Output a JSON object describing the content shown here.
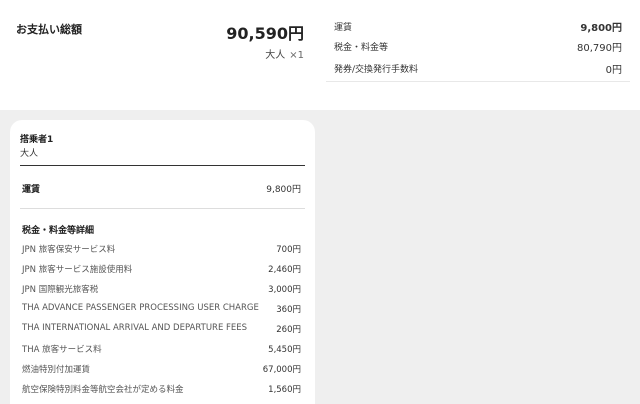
{
  "total": {
    "label": "お支払い総額",
    "amount": "90,590円",
    "passenger_type": "大人",
    "passenger_count": "×1"
  },
  "summary": [
    {
      "label": "運賃",
      "value": "9,800円",
      "bold": true
    },
    {
      "label": "税金・料金等",
      "value": "80,790円",
      "bold": false
    },
    {
      "label": "発券/交換発行手数料",
      "value": "0円",
      "bold": false
    }
  ],
  "passenger": {
    "name": "搭乗者1",
    "type": "大人",
    "fare_label": "運賃",
    "fare_value": "9,800円",
    "details_title": "税金・料金等詳細",
    "details": [
      {
        "label": "JPN 旅客保安サービス料",
        "value": "700円"
      },
      {
        "label": "JPN 旅客サービス施設使用料",
        "value": "2,460円"
      },
      {
        "label": "JPN 国際観光旅客税",
        "value": "3,000円"
      },
      {
        "label": "THA ADVANCE PASSENGER PROCESSING USER CHARGE",
        "value": "360円"
      },
      {
        "label": "THA INTERNATIONAL ARRIVAL AND DEPARTURE FEES",
        "value": "260円"
      },
      {
        "label": "THA 旅客サービス料",
        "value": "5,450円"
      },
      {
        "label": "燃油特別付加運賃",
        "value": "67,000円"
      },
      {
        "label": "航空保険特別料金等航空会社が定める料金",
        "value": "1,560円"
      }
    ]
  }
}
